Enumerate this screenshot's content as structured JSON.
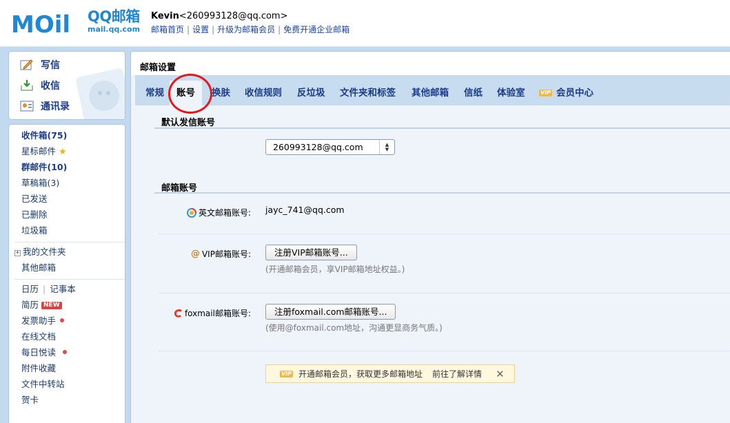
{
  "header": {
    "logo_text": "MOil",
    "logo_qq": "QQ邮箱",
    "logo_url": "mail.qq.com",
    "user_name": "Kevin",
    "user_email": "<260993128@qq.com>",
    "links": [
      "邮箱首页",
      "设置",
      "升级为邮箱会员",
      "免费开通企业邮箱"
    ]
  },
  "actions": {
    "compose": "写信",
    "inbox": "收信",
    "contacts": "通讯录"
  },
  "sidebar": {
    "inbox": "收件箱(75)",
    "starred": "星标邮件",
    "group": "群邮件(10)",
    "drafts": "草稿箱(3)",
    "sent": "已发送",
    "deleted": "已删除",
    "spam": "垃圾箱",
    "my_folders_expand": "+",
    "my_folders": "我的文件夹",
    "other_mail": "其他邮箱",
    "calendar": "日历",
    "calendar_sep": "|",
    "notes": "记事本",
    "resume": "简历",
    "new_badge": "NEW",
    "invoice": "发票助手",
    "docs": "在线文档",
    "daily": "每日悦读",
    "attachments": "附件收藏",
    "transfer": "文件中转站",
    "cards": "贺卡"
  },
  "main": {
    "title": "邮箱设置",
    "tabs": [
      "常规",
      "账号",
      "换肤",
      "收信规则",
      "反垃圾",
      "文件夹和标签",
      "其他邮箱",
      "信纸",
      "体验室",
      "会员中心"
    ],
    "vip_label": "VIP",
    "default_sender": {
      "heading": "默认发信账号",
      "selected": "260993128@qq.com",
      "caret_up": "▲",
      "caret_down": "▼"
    },
    "accounts": {
      "heading": "邮箱账号",
      "english_label": "英文邮箱账号:",
      "english_value": "jayc_741@qq.com",
      "vip_at": "@",
      "vip_label": "VIP邮箱账号:",
      "vip_button": "注册VIP邮箱账号...",
      "vip_hint": "(开通邮箱会员，享VIP邮箱地址权益。)",
      "foxmail_label": "foxmail邮箱账号:",
      "foxmail_button": "注册foxmail.com邮箱账号...",
      "foxmail_hint": "(使用@foxmail.com地址，沟通更显商务气质。)"
    },
    "notice": {
      "text": "开通邮箱会员，获取更多邮箱地址",
      "more": "前往了解详情",
      "close": "✕"
    }
  },
  "colors": {
    "accent": "#1f87d6",
    "frame": "#c3d9f0",
    "annotation": "#e41818"
  }
}
